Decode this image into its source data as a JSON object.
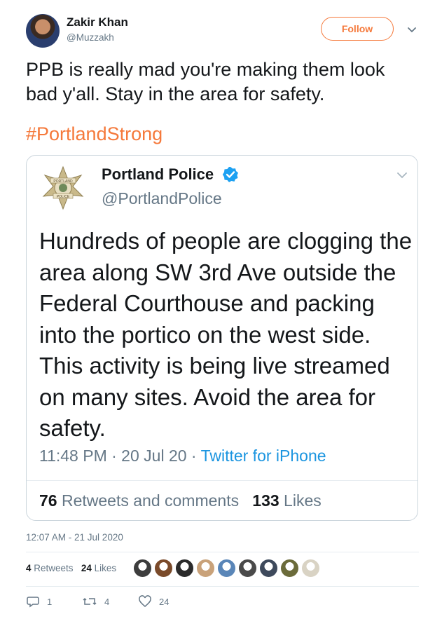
{
  "tweet": {
    "author_name": "Zakir Khan",
    "author_handle": "@Muzzakh",
    "follow_label": "Follow",
    "text": "PPB is really mad you're making them look bad y'all. Stay in the area for safety.",
    "hashtag": "#PortlandStrong",
    "timestamp": "12:07 AM - 21 Jul 2020",
    "retweets_count": "4",
    "retweets_label": "Retweets",
    "likes_count": "24",
    "likes_label": "Likes",
    "actions": {
      "replies": "1",
      "retweets": "4",
      "likes": "24"
    }
  },
  "quoted": {
    "author_name": "Portland Police",
    "author_handle": "@PortlandPolice",
    "badge_text_top": "PORTLAND",
    "badge_text_bottom": "POLICE",
    "text": "Hundreds of people are clogging the area along SW 3rd Ave outside the Federal Courthouse and packing into the portico on the west side. This activity is being live streamed on many sites. Avoid the area for safety.",
    "time": "11:48 PM · 20 Jul 20 · ",
    "source": "Twitter for iPhone",
    "retweets_count": "76",
    "retweets_label": "Retweets and comments",
    "likes_count": "133",
    "likes_label": "Likes"
  },
  "colors": {
    "accent": "#f5793b",
    "link": "#1b95e0",
    "muted": "#657786",
    "verified": "#1da1f2"
  },
  "liker_avatars": [
    "#3d3d3d",
    "#7a4a2a",
    "#2b2b2b",
    "#c9a27a",
    "#5a86b8",
    "#4a4a4a",
    "#3e4a5c",
    "#6b6b3a",
    "#d9d3c4"
  ]
}
